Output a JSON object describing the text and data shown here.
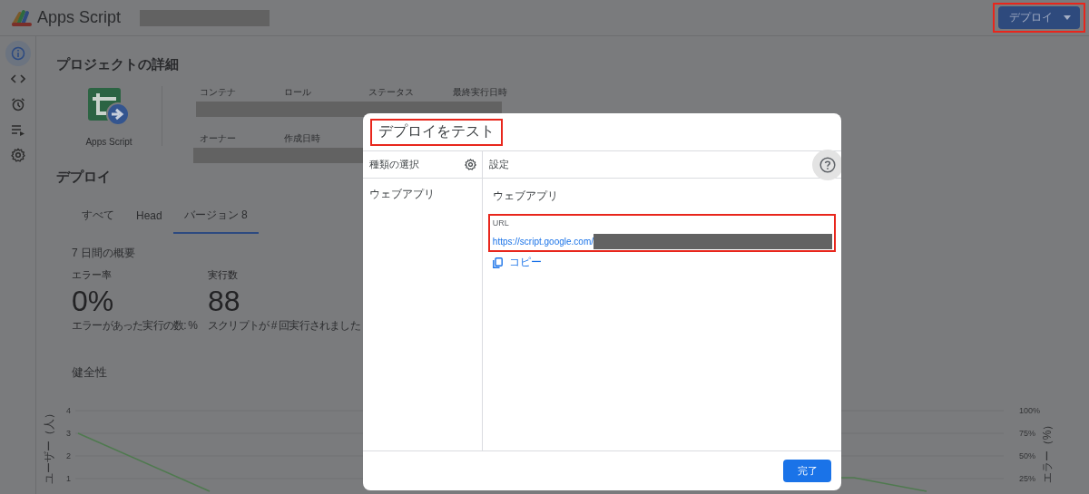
{
  "app_bar": {
    "logo_text": "Apps Script",
    "deploy_button": "デプロイ",
    "deploy_highlighted": true
  },
  "sidebar": {
    "items": [
      {
        "kind": "info",
        "selected": true
      },
      {
        "kind": "code",
        "selected": false
      },
      {
        "kind": "triggers",
        "selected": false
      },
      {
        "kind": "executions",
        "selected": false
      },
      {
        "kind": "settings",
        "selected": false
      }
    ]
  },
  "project_details": {
    "title": "プロジェクトの詳細",
    "icon_caption": "Apps Script",
    "field_rows": [
      [
        "コンテナ",
        "ロール",
        "ステータス",
        "最終実行日時"
      ],
      [
        "オーナー",
        "作成日時"
      ]
    ]
  },
  "deployments": {
    "title": "デプロイ",
    "tabs": [
      {
        "label": "すべて",
        "selected": false
      },
      {
        "label": "Head",
        "selected": false
      },
      {
        "label": "バージョン 8",
        "selected": true
      }
    ],
    "summary_title": "7 日間の概要",
    "metrics": [
      {
        "label": "エラー率",
        "value": "0%",
        "caption": "エラーがあった実行の数: %"
      },
      {
        "label": "実行数",
        "value": "88",
        "caption": "スクリプトが # 回実行されました"
      }
    ]
  },
  "health": {
    "title": "健全性",
    "left_axis_label": "ユーザー（人）",
    "left_ticks": [
      "4",
      "3",
      "2",
      "1"
    ],
    "right_axis_label": "エラー（%）",
    "right_ticks": [
      "100%",
      "75%",
      "50%",
      "25%"
    ]
  },
  "dialog": {
    "title": "デプロイをテスト",
    "title_highlighted": true,
    "types_header": "種類の選択",
    "settings_header": "設定",
    "types": [
      "ウェブアプリ"
    ],
    "section_title": "ウェブアプリ",
    "url_label": "URL",
    "url": "https://script.google.com/",
    "url_highlighted": true,
    "copy_label": "コピー",
    "done_button": "完了"
  }
}
